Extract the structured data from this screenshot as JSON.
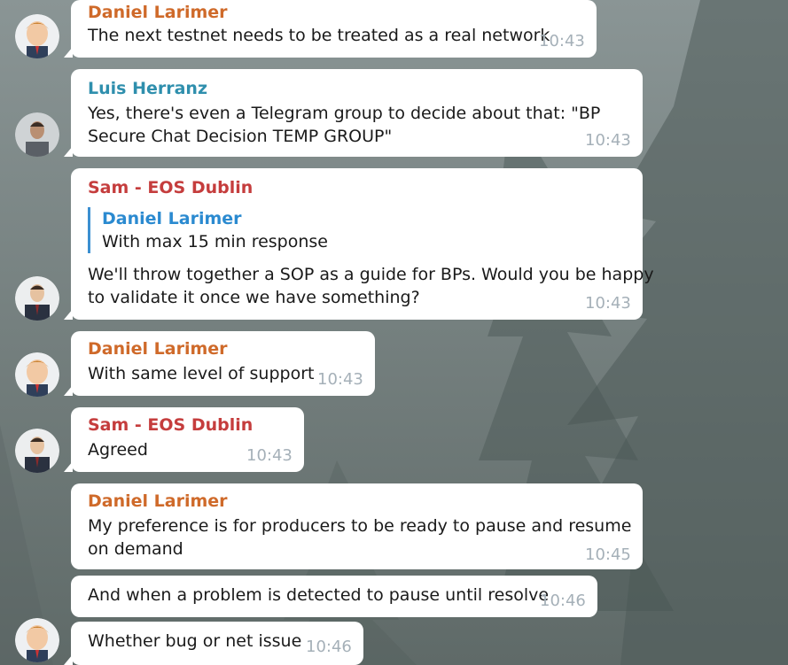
{
  "colors": {
    "daniel": "#cf6a2a",
    "luis": "#2f8fad",
    "sam": "#c53d3d",
    "reply_accent": "#2b8ad0",
    "timestamp": "#a5b0b8"
  },
  "messages": [
    {
      "sender": "Daniel Larimer",
      "text": "The next testnet needs to be treated as a real network",
      "time": "10:43"
    },
    {
      "sender": "Luis Herranz",
      "text_lines": [
        "Yes, there's even a Telegram group to decide about that: \"BP",
        "Secure Chat Decision TEMP GROUP\""
      ],
      "time": "10:43"
    },
    {
      "sender": "Sam - EOS Dublin",
      "reply_to": {
        "name": "Daniel Larimer",
        "text": "With max 15 min response"
      },
      "text_lines": [
        "We'll throw together a SOP as a guide for BPs. Would you be happy",
        "to validate it once we have something?"
      ],
      "time": "10:43"
    },
    {
      "sender": "Daniel Larimer",
      "text": "With same level of support",
      "time": "10:43"
    },
    {
      "sender": "Sam - EOS Dublin",
      "text": "Agreed",
      "time": "10:43"
    },
    {
      "sender": "Daniel Larimer",
      "text_lines": [
        "My preference is for producers to be ready to pause and resume",
        "on demand"
      ],
      "time": "10:45"
    },
    {
      "text": "And when a problem is detected to pause until resolve",
      "time": "10:46"
    },
    {
      "text": "Whether bug or net issue",
      "time": "10:46"
    }
  ]
}
